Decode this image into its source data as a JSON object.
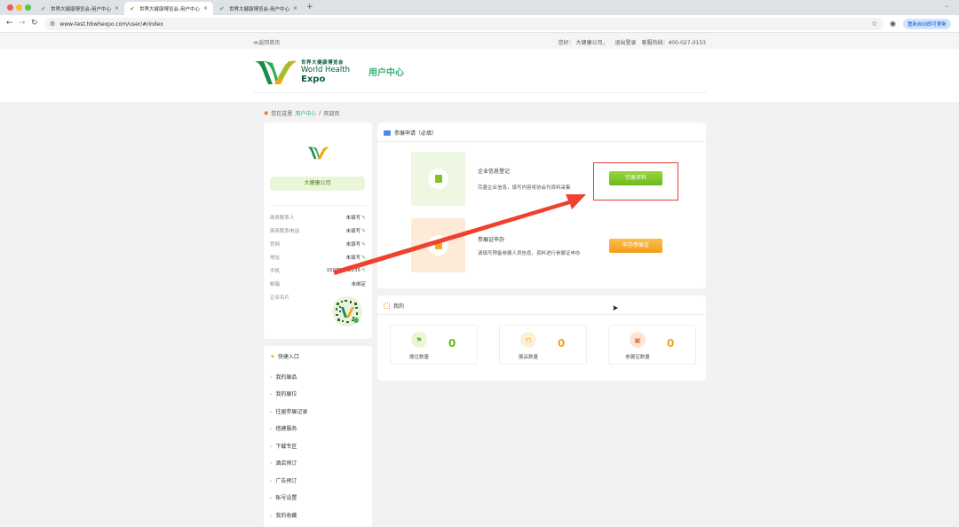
{
  "browser": {
    "tabs": [
      {
        "title": "世界大健康博览会-用户中心",
        "active": false
      },
      {
        "title": "世界大健康博览会-用户中心",
        "active": true
      },
      {
        "title": "世界大健康博览会-用户中心",
        "active": false
      }
    ],
    "new_tab": "+",
    "url": "www-test.hbwhexpo.com/user/#/index",
    "update_button": "重新启动即可更新"
  },
  "topbar": {
    "back_home": "≪返回首页",
    "welcome": "您好：",
    "company": "大健康公司，",
    "logout": "退出登录",
    "hotline": "客服热线：400-027-0153"
  },
  "header": {
    "logo_cn": "世界大健康博览会",
    "logo_en1": "World Health",
    "logo_en2": "Expo",
    "title": "用户中心"
  },
  "breadcrumb": {
    "prefix": "您在这里",
    "link": "用户中心",
    "sep": "/",
    "current": "欢迎页"
  },
  "profile": {
    "company_name": "大健康公司",
    "rows": [
      {
        "label": "商务联系人",
        "value": "未填写"
      },
      {
        "label": "商务联系电话",
        "value": "未填写"
      },
      {
        "label": "官网",
        "value": "未填写"
      },
      {
        "label": "地址",
        "value": "未填写"
      },
      {
        "label": "手机",
        "value": "15072342235"
      },
      {
        "label": "邮箱",
        "value": "未绑定"
      },
      {
        "label": "企业名片",
        "value": ""
      }
    ]
  },
  "quick": {
    "title": "快捷入口",
    "items": [
      "我的展品",
      "我的展位",
      "往届参展记录",
      "搭建服务",
      "下载专区",
      "酒店预订",
      "广告预订",
      "账号设置",
      "我的收藏"
    ]
  },
  "apply": {
    "title": "参展申请（必填）",
    "row1_title": "企业信息登记",
    "row1_desc": "完善企业信息，填写内容将协会刊资料采集",
    "row1_button": "完善资料",
    "row2_title": "参展证申办",
    "row2_desc": "请填写预备参展人员信息，资料进行参展证申办",
    "row2_button": "申办参展证"
  },
  "mine": {
    "title": "我的",
    "stats": [
      {
        "label": "展位数量",
        "value": "0",
        "color": "#6ab81f"
      },
      {
        "label": "展品数量",
        "value": "0",
        "color": "#f2a423"
      },
      {
        "label": "参展证数量",
        "value": "0",
        "color": "#f2a423"
      }
    ]
  },
  "colors": {
    "brand_green": "#2fb276",
    "button_green": "#7cc529",
    "button_orange": "#f5a623",
    "highlight_red": "#e43e2f"
  },
  "icons": {
    "pencil": "✎",
    "chevron": "›",
    "pin": "◉",
    "star": "☆"
  }
}
